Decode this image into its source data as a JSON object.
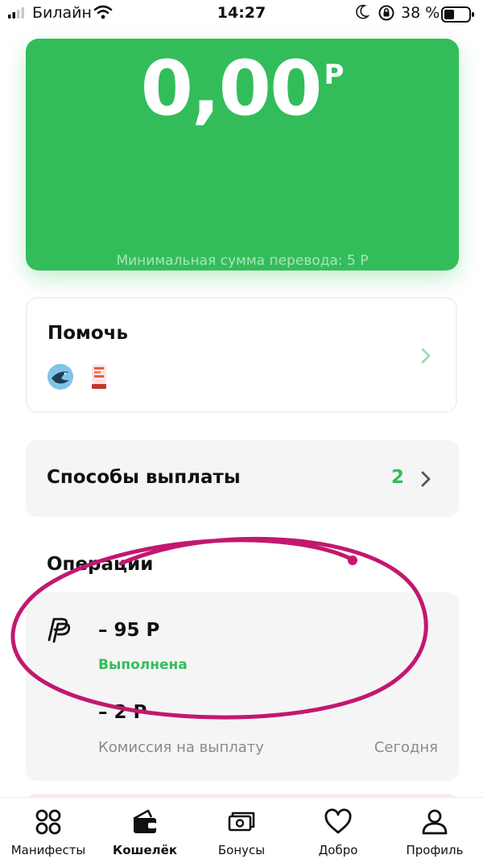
{
  "status_bar": {
    "carrier": "Билайн",
    "time": "14:27",
    "battery_percent": "38 %"
  },
  "balance": {
    "amount": "0,00",
    "currency": "Р",
    "min_transfer_text": "Минимальная сумма перевода: 5 Р"
  },
  "help": {
    "title": "Помочь",
    "logos": [
      "bird-logo-icon",
      "charity-logo-icon"
    ]
  },
  "payout": {
    "label": "Способы выплаты",
    "count": "2"
  },
  "operations": {
    "title": "Операции",
    "items": [
      {
        "amount": "– 95 Р",
        "status": "Выполнена",
        "icon": "paypal-icon"
      },
      {
        "amount": "– 2 Р",
        "description": "Комиссия на выплату",
        "date": "Сегодня"
      }
    ]
  },
  "tabs": [
    {
      "label": "Манифесты",
      "icon": "grid-circles-icon",
      "active": false
    },
    {
      "label": "Кошелёк",
      "icon": "wallet-icon",
      "active": true
    },
    {
      "label": "Бонусы",
      "icon": "banknotes-icon",
      "active": false
    },
    {
      "label": "Добро",
      "icon": "heart-icon",
      "active": false
    },
    {
      "label": "Профиль",
      "icon": "profile-icon",
      "active": false
    }
  ],
  "colors": {
    "accent": "#33bd5a",
    "annotation": "#c2186f"
  }
}
